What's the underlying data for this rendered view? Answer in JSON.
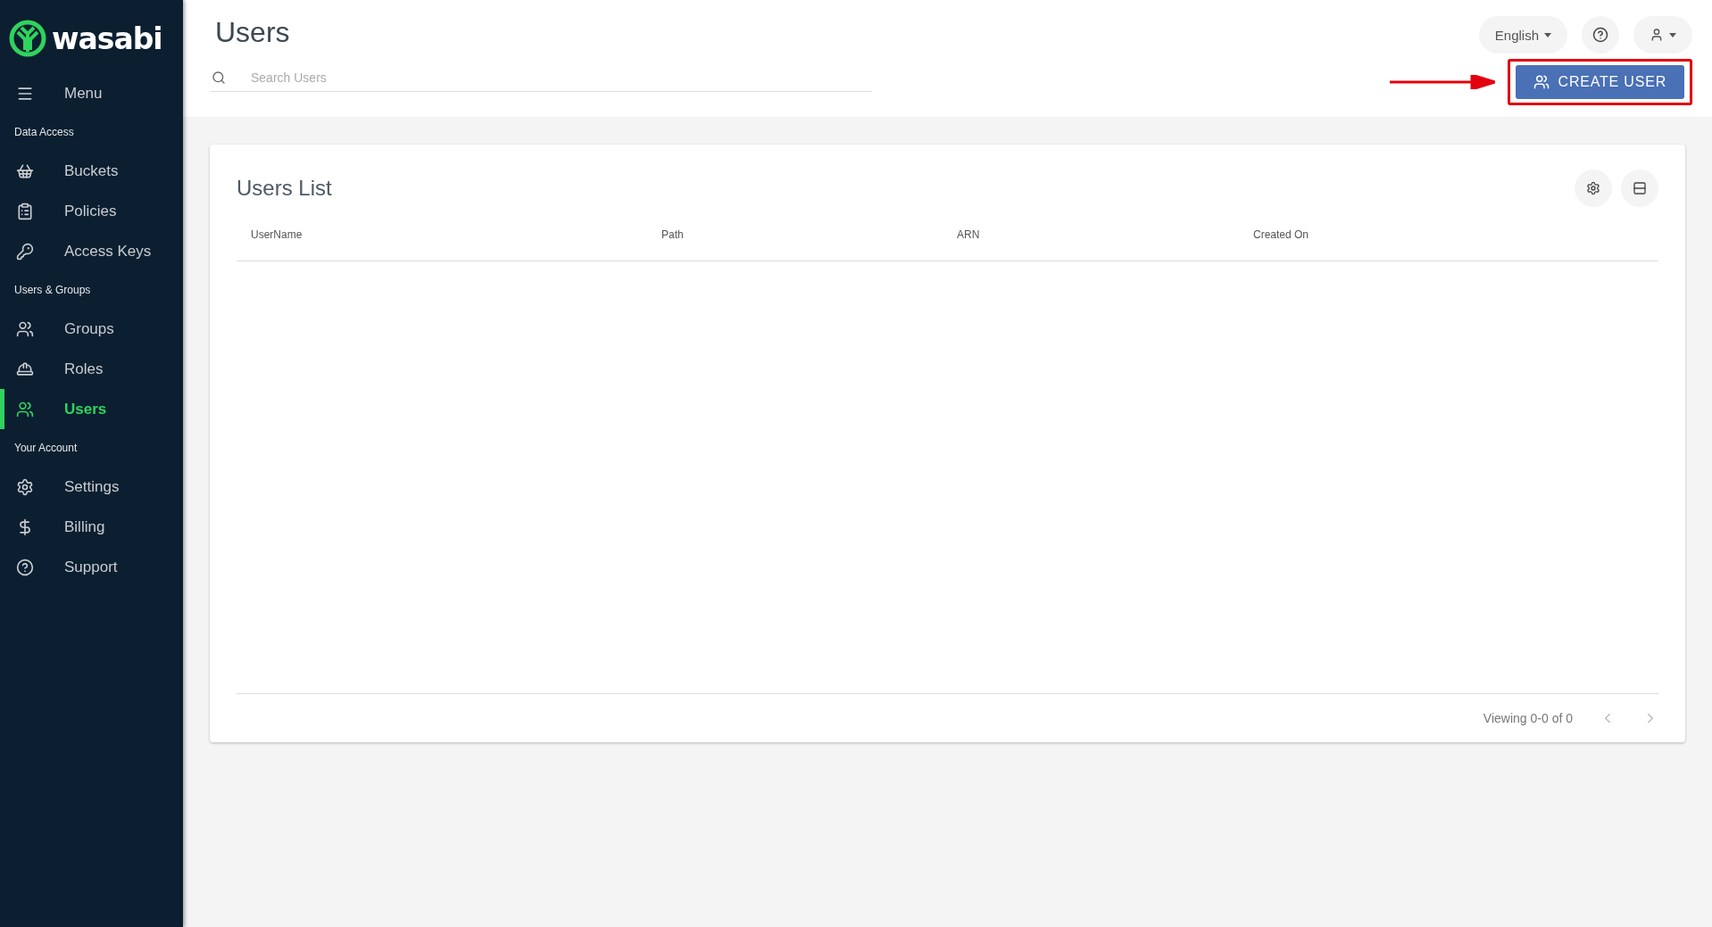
{
  "brand": {
    "name": "wasabi"
  },
  "sidebar": {
    "menu_label": "Menu",
    "items": [
      {
        "kind": "section",
        "label": "Data Access"
      },
      {
        "kind": "link",
        "label": "Buckets",
        "selected": false
      },
      {
        "kind": "link",
        "label": "Policies",
        "selected": false
      },
      {
        "kind": "link",
        "label": "Access Keys",
        "selected": false
      },
      {
        "kind": "section",
        "label": "Users & Groups"
      },
      {
        "kind": "link",
        "label": "Groups",
        "selected": false
      },
      {
        "kind": "link",
        "label": "Roles",
        "selected": false
      },
      {
        "kind": "link",
        "label": "Users",
        "selected": true
      },
      {
        "kind": "section",
        "label": "Your Account"
      },
      {
        "kind": "link",
        "label": "Settings",
        "selected": false
      },
      {
        "kind": "link",
        "label": "Billing",
        "selected": false
      },
      {
        "kind": "link",
        "label": "Support",
        "selected": false
      }
    ]
  },
  "header": {
    "title": "Users",
    "search": {
      "placeholder": "Search Users"
    },
    "language": "English",
    "create_button": "CREATE USER"
  },
  "table": {
    "title": "Users List",
    "columns": [
      "UserName",
      "Path",
      "ARN",
      "Created On"
    ],
    "pagination": "Viewing 0-0 of 0"
  }
}
